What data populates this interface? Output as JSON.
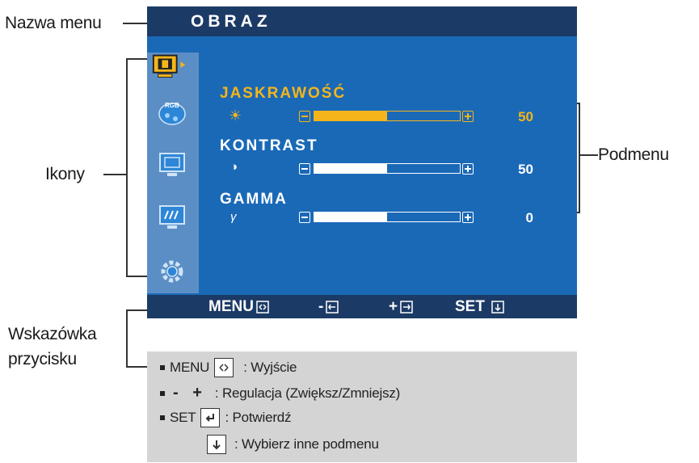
{
  "callouts": {
    "menu_name": "Nazwa menu",
    "icons": "Ikony",
    "submenu": "Podmenu",
    "button_hint_line1": "Wskazówka",
    "button_hint_line2": "przycisku"
  },
  "osd": {
    "title": "OBRAZ",
    "sidebar_icons": [
      "picture-icon",
      "rgb-color-icon",
      "display-setup-icon",
      "screen-wave-icon",
      "settings-gear-icon"
    ],
    "rgb_label": "RGB",
    "items": [
      {
        "label": "JASKRAWOŚĆ",
        "value": "50",
        "level": 0.5,
        "symbol": "☀",
        "active": true
      },
      {
        "label": "KONTRAST",
        "value": "50",
        "level": 0.5,
        "symbol": "◑",
        "active": false
      },
      {
        "label": "GAMMA",
        "value": "0",
        "level": 0.5,
        "symbol": "γ",
        "active": false
      }
    ],
    "footer": {
      "menu": "MENU",
      "minus": "-",
      "plus": "+",
      "set": "SET"
    },
    "colors": {
      "accent": "#f5b51a",
      "panel": "#1a69b7",
      "title_bar": "#1c3a66",
      "sidebar": "#5c8ec6"
    }
  },
  "legend": {
    "menu_label": "MENU",
    "menu_desc": ": Wyjście",
    "adjust_symbols": "- +",
    "adjust_desc": ": Regulacja (Zwiększ/Zmniejsz)",
    "set_label": "SET",
    "set_desc": ": Potwierdź",
    "select_desc": ": Wybierz inne podmenu"
  }
}
